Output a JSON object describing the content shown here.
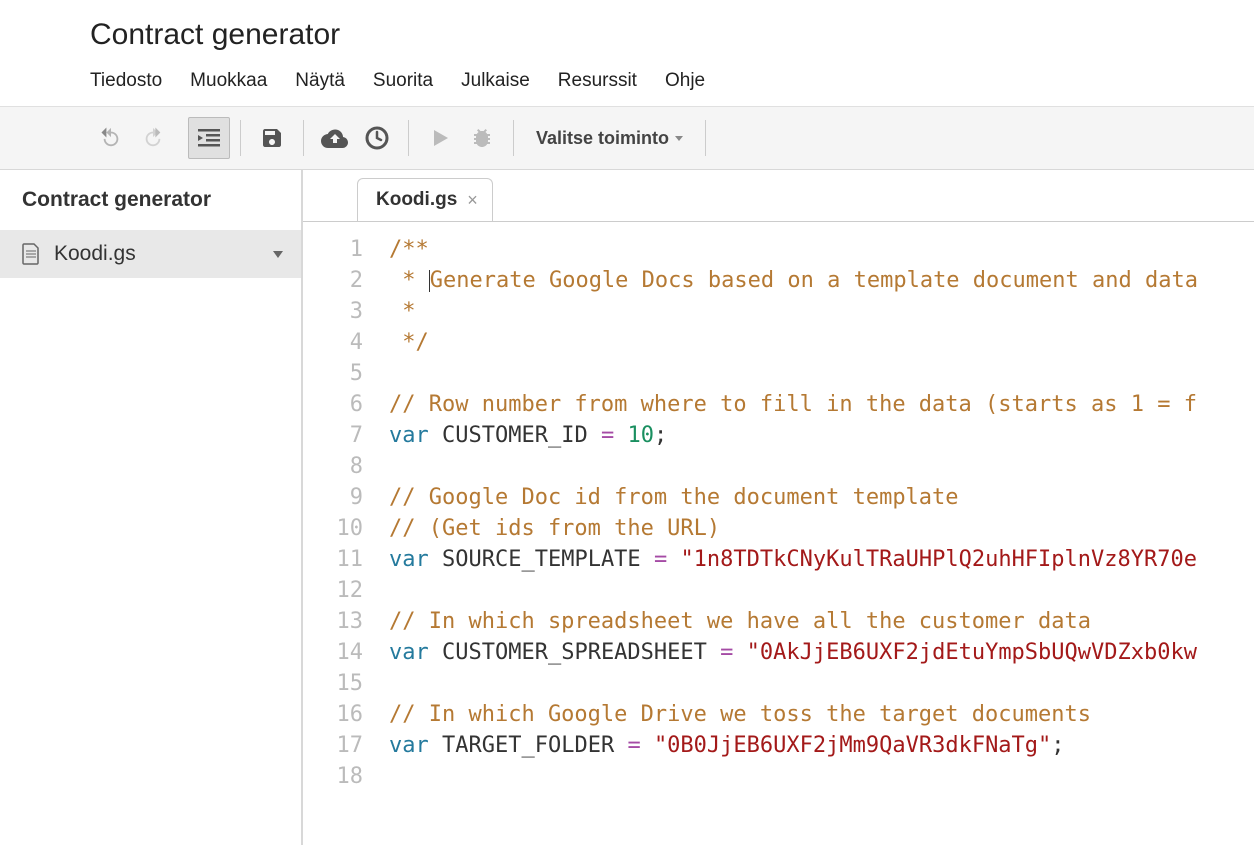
{
  "header": {
    "title": "Contract generator",
    "menus": [
      "Tiedosto",
      "Muokkaa",
      "Näytä",
      "Suorita",
      "Julkaise",
      "Resurssit",
      "Ohje"
    ]
  },
  "toolbar": {
    "function_select": "Valitse toiminto"
  },
  "sidebar": {
    "project_name": "Contract generator",
    "files": [
      {
        "name": "Koodi.gs"
      }
    ]
  },
  "tabs": [
    {
      "name": "Koodi.gs"
    }
  ],
  "code": {
    "lines": [
      {
        "n": 1,
        "tokens": [
          {
            "t": "/**",
            "c": "cm-comment"
          }
        ]
      },
      {
        "n": 2,
        "tokens": [
          {
            "t": " * ",
            "c": "cm-comment"
          },
          {
            "cursor": true
          },
          {
            "t": "Generate Google Docs based on a template document and data",
            "c": "cm-comment"
          }
        ]
      },
      {
        "n": 3,
        "tokens": [
          {
            "t": " *",
            "c": "cm-comment"
          }
        ]
      },
      {
        "n": 4,
        "tokens": [
          {
            "t": " */",
            "c": "cm-comment"
          }
        ]
      },
      {
        "n": 5,
        "tokens": []
      },
      {
        "n": 6,
        "tokens": [
          {
            "t": "// Row number from where to fill in the data (starts as 1 = f",
            "c": "cm-comment"
          }
        ]
      },
      {
        "n": 7,
        "tokens": [
          {
            "t": "var",
            "c": "cm-keyword"
          },
          {
            "t": " "
          },
          {
            "t": "CUSTOMER_ID",
            "c": "cm-var"
          },
          {
            "t": " "
          },
          {
            "t": "=",
            "c": "cm-op"
          },
          {
            "t": " "
          },
          {
            "t": "10",
            "c": "cm-num"
          },
          {
            "t": ";",
            "c": "cm-var"
          }
        ]
      },
      {
        "n": 8,
        "tokens": []
      },
      {
        "n": 9,
        "tokens": [
          {
            "t": "// Google Doc id from the document template",
            "c": "cm-comment"
          }
        ]
      },
      {
        "n": 10,
        "tokens": [
          {
            "t": "// (Get ids from the URL)",
            "c": "cm-comment"
          }
        ]
      },
      {
        "n": 11,
        "tokens": [
          {
            "t": "var",
            "c": "cm-keyword"
          },
          {
            "t": " "
          },
          {
            "t": "SOURCE_TEMPLATE",
            "c": "cm-var"
          },
          {
            "t": " "
          },
          {
            "t": "=",
            "c": "cm-op"
          },
          {
            "t": " "
          },
          {
            "t": "\"1n8TDTkCNyKulTRaUHPlQ2uhHFIplnVz8YR70e",
            "c": "cm-str"
          }
        ]
      },
      {
        "n": 12,
        "tokens": []
      },
      {
        "n": 13,
        "tokens": [
          {
            "t": "// In which spreadsheet we have all the customer data",
            "c": "cm-comment"
          }
        ]
      },
      {
        "n": 14,
        "tokens": [
          {
            "t": "var",
            "c": "cm-keyword"
          },
          {
            "t": " "
          },
          {
            "t": "CUSTOMER_SPREADSHEET",
            "c": "cm-var"
          },
          {
            "t": " "
          },
          {
            "t": "=",
            "c": "cm-op"
          },
          {
            "t": " "
          },
          {
            "t": "\"0AkJjEB6UXF2jdEtuYmpSbUQwVDZxb0kw",
            "c": "cm-str"
          }
        ]
      },
      {
        "n": 15,
        "tokens": []
      },
      {
        "n": 16,
        "tokens": [
          {
            "t": "// In which Google Drive we toss the target documents",
            "c": "cm-comment"
          }
        ]
      },
      {
        "n": 17,
        "tokens": [
          {
            "t": "var",
            "c": "cm-keyword"
          },
          {
            "t": " "
          },
          {
            "t": "TARGET_FOLDER",
            "c": "cm-var"
          },
          {
            "t": " "
          },
          {
            "t": "=",
            "c": "cm-op"
          },
          {
            "t": " "
          },
          {
            "t": "\"0B0JjEB6UXF2jMm9QaVR3dkFNaTg\"",
            "c": "cm-str"
          },
          {
            "t": ";",
            "c": "cm-var"
          }
        ]
      },
      {
        "n": 18,
        "tokens": []
      }
    ]
  }
}
